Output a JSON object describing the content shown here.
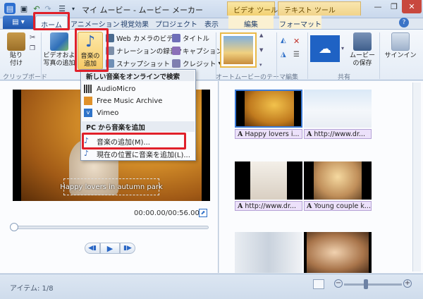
{
  "window": {
    "title": "マイ ムービー - ムービー メーカー",
    "context_tabs": [
      "ビデオ ツール",
      "テキスト ツール"
    ]
  },
  "tabs": {
    "file_label": "",
    "items": [
      "ホーム",
      "アニメーション",
      "視覚効果",
      "プロジェクト",
      "表示",
      "編集",
      "フォーマット"
    ]
  },
  "ribbon": {
    "paste": "貼り\n付け",
    "clipboard_group": "クリップボード",
    "add_media": "ビデオおよ\n写真の追加",
    "add_music": "音楽の\n追加",
    "webcam": "Web カメラのビデオ",
    "narration": "ナレーションの録音",
    "snapshot": "スナップショット",
    "title": "タイトル",
    "caption": "キャプション",
    "credits": "クレジット",
    "themes_group": "オートムービーのテーマ",
    "edit_group": "編集",
    "share_group": "共有",
    "save_movie": "ムービー\nの保存",
    "sign_in": "サインイン"
  },
  "menu": {
    "online_header": "新しい音楽をオンラインで検索",
    "online_items": [
      "AudioMicro",
      "Free Music Archive",
      "Vimeo"
    ],
    "pc_header": "PC から音楽を追加",
    "add_music": "音楽の追加(M)...",
    "add_music_at_point": "現在の位置に音楽を追加(L)..."
  },
  "preview": {
    "caption_text": "Happy lovers in autumn park",
    "timecode": "00:00.00/00:56.00"
  },
  "storyboard": {
    "captions": [
      "Happy lovers i...",
      "http://www.dr...",
      "http://www.dr...",
      "Young couple k..."
    ]
  },
  "status": {
    "items": "アイテム: 1/8"
  },
  "colors": {
    "highlight": "#e0202a",
    "file_tab": "#1e56ad",
    "caption_strip": "#ece1fa"
  }
}
